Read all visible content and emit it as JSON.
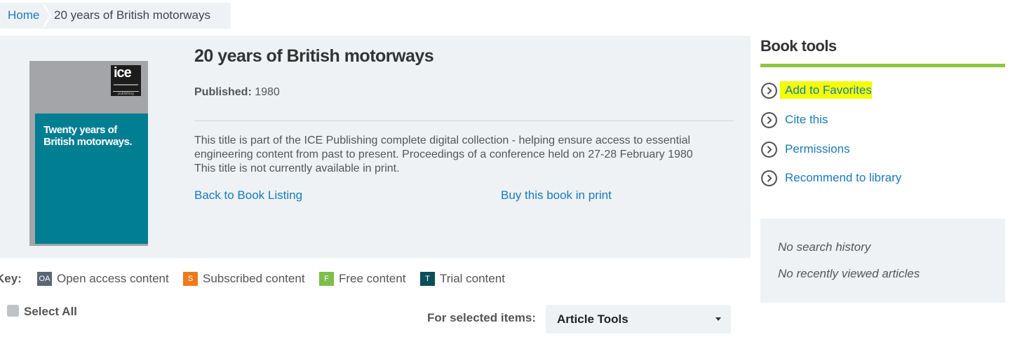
{
  "breadcrumb": {
    "home": "Home",
    "current": "20 years of British motorways"
  },
  "book": {
    "title": "20 years of British motorways",
    "published_label": "Published:",
    "published_year": "1980",
    "description_line1": "This title is part of the ICE Publishing complete digital collection - helping ensure access to essential",
    "description_line2": "engineering content from past to present. Proceedings of a conference held on 27-28 February 1980",
    "description_line3": "This title is not currently available in print.",
    "back_link": "Back to Book Listing",
    "buy_link": "Buy this book in print",
    "cover": {
      "logo_text": "ice",
      "logo_sub": "publishing",
      "title_line1": "Twenty years of",
      "title_line2": "British motorways.",
      "colors": {
        "top": "#a3a5a8",
        "main": "#027e93"
      }
    }
  },
  "key": {
    "label": "Key:",
    "items": [
      {
        "badge": "OA",
        "label": "Open access content",
        "color": "#5b6574"
      },
      {
        "badge": "S",
        "label": "Subscribed content",
        "color": "#f07a1b"
      },
      {
        "badge": "F",
        "label": "Free content",
        "color": "#7cc04b"
      },
      {
        "badge": "T",
        "label": "Trial content",
        "color": "#0b4e5a"
      }
    ]
  },
  "selection": {
    "select_all": "Select All",
    "for_selected": "For selected items:",
    "article_tools": "Article Tools"
  },
  "sidebar": {
    "heading": "Book tools",
    "accent_color": "#8dc63f",
    "tools": [
      {
        "label": "Add to Favorites",
        "icon": "chevron-circle-right-icon"
      },
      {
        "label": "Cite this",
        "icon": "chevron-circle-right-icon"
      },
      {
        "label": "Permissions",
        "icon": "chevron-circle-right-icon"
      },
      {
        "label": "Recommend to library",
        "icon": "chevron-circle-right-icon"
      }
    ],
    "search_history": "No search history",
    "recent_articles": "No recently viewed articles"
  }
}
